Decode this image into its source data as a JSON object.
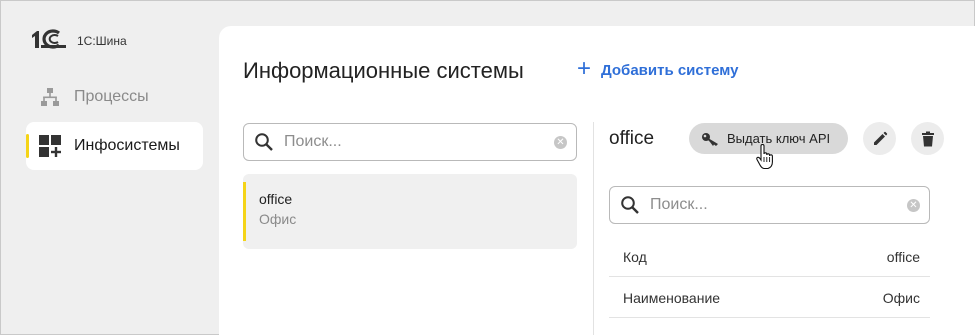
{
  "app": {
    "logo_text": "1С:Шина"
  },
  "sidebar": {
    "items": [
      {
        "label": "Процессы",
        "icon": "sitemap-icon",
        "active": false
      },
      {
        "label": "Инфосистемы",
        "icon": "dashboard-add-icon",
        "active": true
      }
    ]
  },
  "main": {
    "title": "Информационные системы",
    "add_label": "Добавить систему",
    "list_search": {
      "placeholder": "Поиск..."
    },
    "list": [
      {
        "name": "office",
        "description": "Офис"
      }
    ]
  },
  "detail": {
    "title": "office",
    "api_key_label": "Выдать ключ API",
    "search": {
      "placeholder": "Поиск..."
    },
    "properties": [
      {
        "key": "Код",
        "value": "office"
      },
      {
        "key": "Наименование",
        "value": "Офис"
      }
    ]
  },
  "colors": {
    "accent": "#2f6fd8",
    "active_marker": "#f5d417"
  }
}
